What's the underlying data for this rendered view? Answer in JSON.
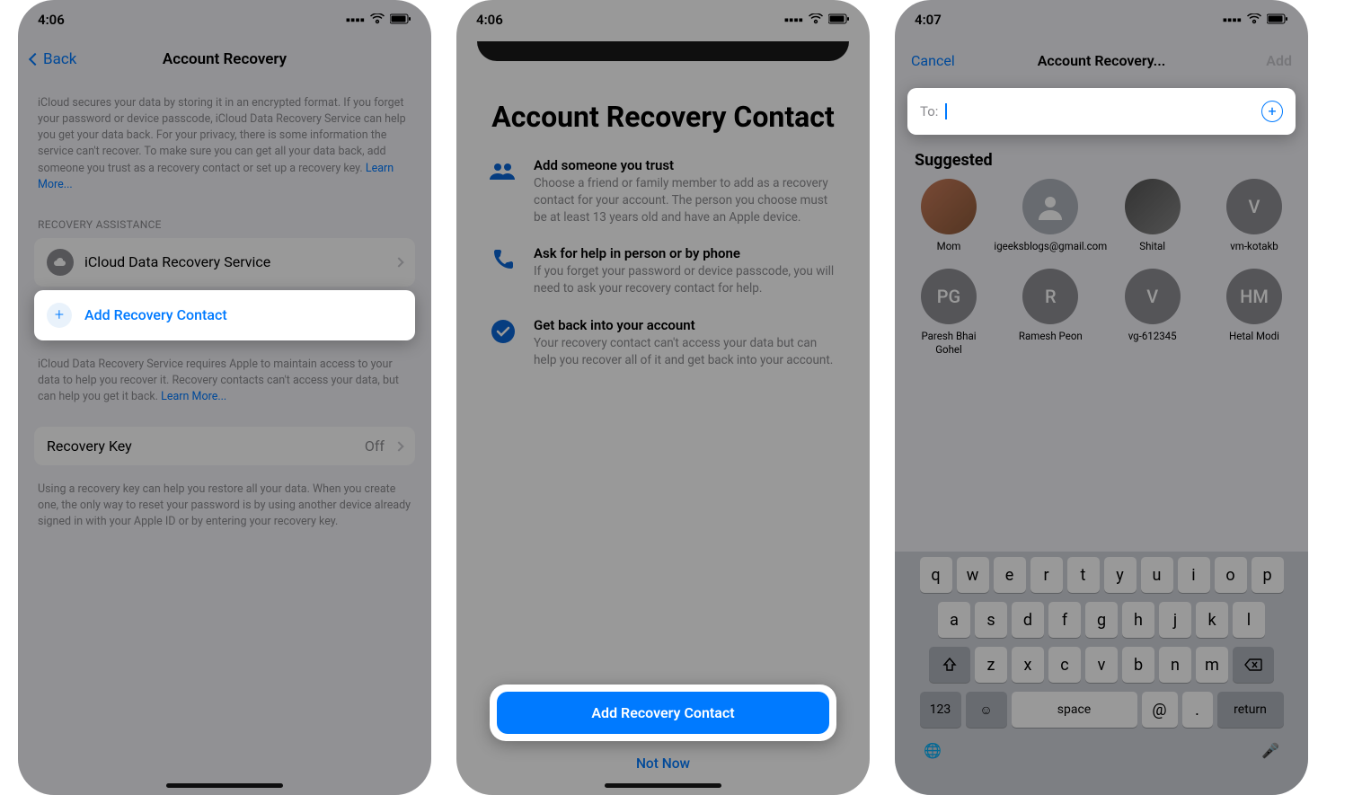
{
  "screen1": {
    "status": {
      "time": "4:06",
      "signal": "•••",
      "wifi": "wifi",
      "battery": "bat"
    },
    "nav": {
      "back": "Back",
      "title": "Account Recovery"
    },
    "intro": "iCloud secures your data by storing it in an encrypted format. If you forget your password or device passcode, iCloud Data Recovery Service can help you get your data back. For your privacy, there is some information the service can't recover. To make sure you can get all your data back, add someone you trust as a recovery contact or set up a recovery key.",
    "learn_more": "Learn More...",
    "recovery_assistance": "RECOVERY ASSISTANCE",
    "icloud_service": "iCloud Data Recovery Service",
    "add_contact": "Add Recovery Contact",
    "service_footer": "iCloud Data Recovery Service requires Apple to maintain access to your data to help you recover it. Recovery contacts can't access your data, but can help you get it back.",
    "recovery_key": {
      "label": "Recovery Key",
      "value": "Off"
    },
    "key_footer": "Using a recovery key can help you restore all your data. When you create one, the only way to reset your password is by using another device already signed in with your Apple ID or by entering your recovery key."
  },
  "screen2": {
    "status": {
      "time": "4:06"
    },
    "title": "Account Recovery Contact",
    "f1": {
      "h": "Add someone you trust",
      "p": "Choose a friend or family member to add as a recovery contact for your account. The person you choose must be at least 13 years old and have an Apple device."
    },
    "f2": {
      "h": "Ask for help in person or by phone",
      "p": "If you forget your password or device passcode, you will need to ask your recovery contact for help."
    },
    "f3": {
      "h": "Get back into your account",
      "p": "Your recovery contact can't access your data but can help you recover all of it and get back into your account."
    },
    "primary": "Add Recovery Contact",
    "secondary": "Not Now"
  },
  "screen3": {
    "status": {
      "time": "4:07"
    },
    "nav": {
      "cancel": "Cancel",
      "title": "Account Recovery...",
      "add": "Add"
    },
    "to_label": "To:",
    "to_placeholder": "",
    "suggested": "Suggested",
    "contacts_row1": [
      {
        "name": "Mom",
        "initials": "",
        "photo": "photo1"
      },
      {
        "name": "igeeksblogs@gmail.com",
        "initials": "",
        "photo": "placeholder"
      },
      {
        "name": "Shital",
        "initials": "",
        "photo": "photo2"
      },
      {
        "name": "vm-kotakb",
        "initials": "V",
        "photo": ""
      }
    ],
    "contacts_row2": [
      {
        "name": "Paresh Bhai Gohel",
        "initials": "PG",
        "photo": ""
      },
      {
        "name": "Ramesh Peon",
        "initials": "R",
        "photo": ""
      },
      {
        "name": "vg-612345",
        "initials": "V",
        "photo": ""
      },
      {
        "name": "Hetal Modi",
        "initials": "HM",
        "photo": ""
      }
    ],
    "keyboard": {
      "r1": [
        "q",
        "w",
        "e",
        "r",
        "t",
        "y",
        "u",
        "i",
        "o",
        "p"
      ],
      "r2": [
        "a",
        "s",
        "d",
        "f",
        "g",
        "h",
        "j",
        "k",
        "l"
      ],
      "r3": [
        "z",
        "x",
        "c",
        "v",
        "b",
        "n",
        "m"
      ],
      "num": "123",
      "space": "space",
      "at": "@",
      "dot": ".",
      "ret": "return"
    }
  }
}
